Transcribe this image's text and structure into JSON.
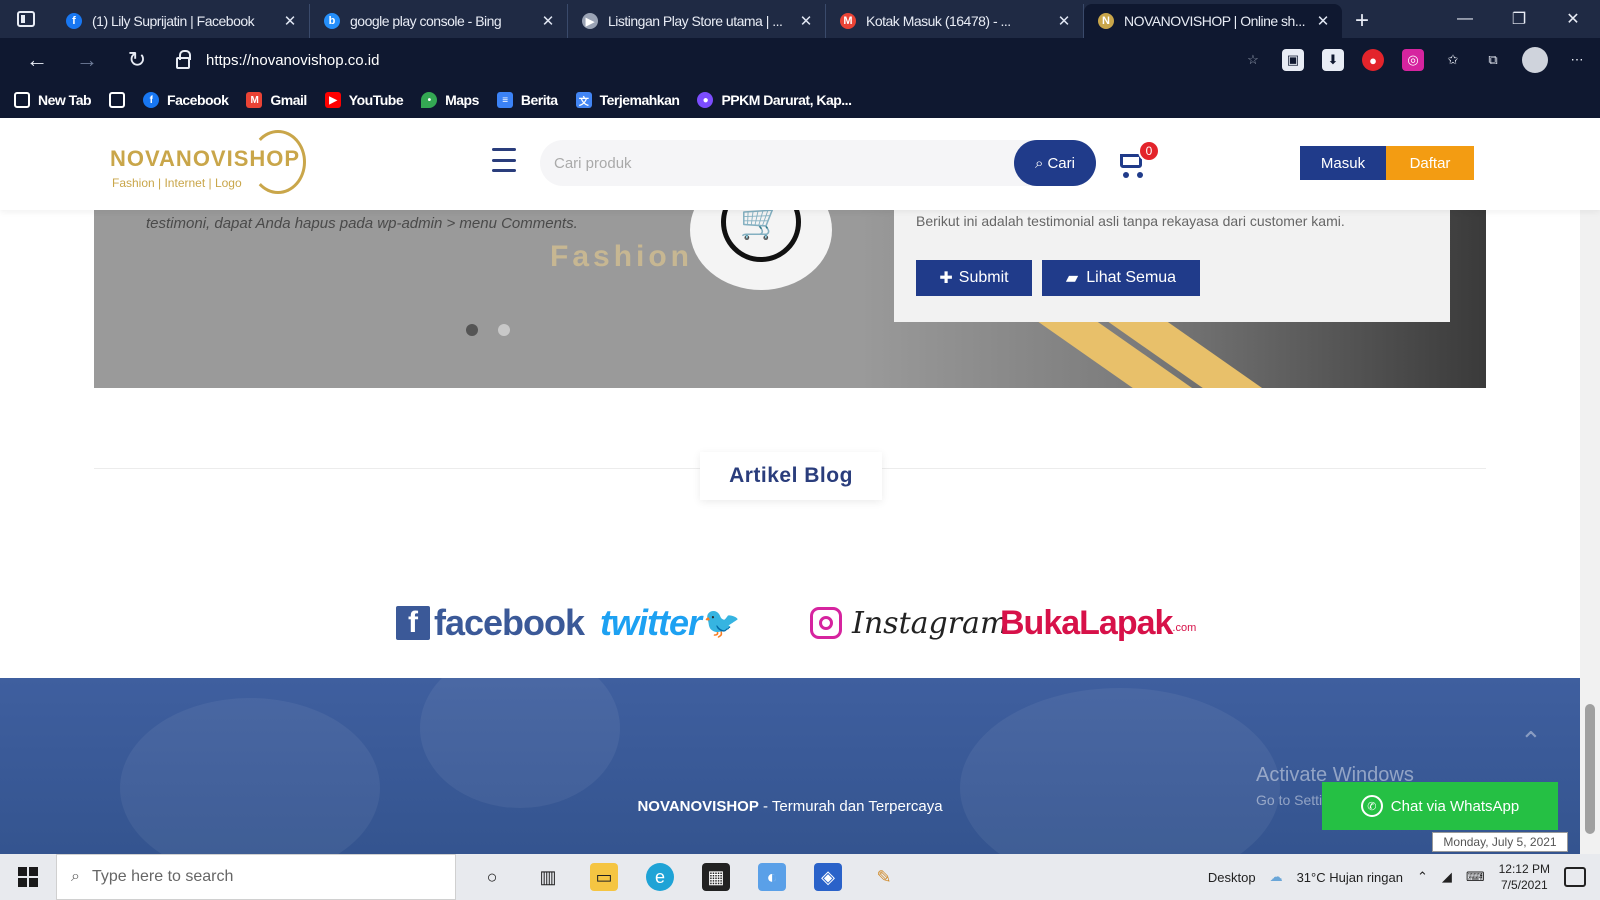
{
  "browser": {
    "tabs": [
      {
        "title": "(1) Lily Suprijatin | Facebook",
        "icon": "facebook-icon",
        "color": "#1877f2"
      },
      {
        "title": "google play console - Bing",
        "icon": "bing-icon",
        "color": "#258ffa"
      },
      {
        "title": "Listingan Play Store utama | ...",
        "icon": "play-console-icon",
        "color": "#9aa3b5"
      },
      {
        "title": "Kotak Masuk (16478) - ...",
        "icon": "gmail-icon",
        "color": "#ea4335"
      },
      {
        "title": "NOVANOVISHOP | Online sh...",
        "icon": "novanovishop-icon",
        "color": "#c9a64a",
        "active": true
      }
    ],
    "new_tab": "+",
    "url": "https://novanovishop.co.id",
    "bookmarks": [
      {
        "label": "New Tab",
        "icon": "page-icon",
        "color": "#0f1830"
      },
      {
        "label": "",
        "icon": "page-icon",
        "color": "#0f1830"
      },
      {
        "label": "Facebook",
        "icon": "facebook-icon",
        "color": "#1877f2"
      },
      {
        "label": "Gmail",
        "icon": "gmail-icon",
        "color": "#ea4335"
      },
      {
        "label": "YouTube",
        "icon": "youtube-icon",
        "color": "#ff0000"
      },
      {
        "label": "Maps",
        "icon": "maps-icon",
        "color": "#34a853"
      },
      {
        "label": "Berita",
        "icon": "news-icon",
        "color": "#3b82f6"
      },
      {
        "label": "Terjemahkan",
        "icon": "translate-icon",
        "color": "#4285f4"
      },
      {
        "label": "PPKM Darurat, Kap...",
        "icon": "news-icon",
        "color": "#7c4dff"
      }
    ]
  },
  "header": {
    "logo_name": "NOVANOVISHOP",
    "logo_tagline": "Fashion | Internet | Logo",
    "search_placeholder": "Cari produk",
    "search_button": "Cari",
    "cart_count": "0",
    "login": "Masuk",
    "register": "Daftar"
  },
  "banner": {
    "testimonial_text": "testimoni, dapat Anda hapus pada wp-admin > menu Comments.",
    "watermark": "Fashion   net",
    "box_text": "Berikut ini adalah testimonial asli tanpa rekayasa dari customer kami.",
    "submit_button": "Submit",
    "view_all_button": "Lihat Semua",
    "slide_count": 2,
    "active_slide": 1
  },
  "blog": {
    "title": "Artikel Blog"
  },
  "social": {
    "facebook": "facebook",
    "twitter": "twitter",
    "instagram": "Instagram",
    "bukalapak": "BukaLapak",
    "bukalapak_suffix": ".com"
  },
  "footer": {
    "brand": "NOVANOVISHOP",
    "tagline": " - Termurah dan Terpercaya",
    "activate_title": "Activate Windows",
    "activate_sub": "Go to Settings",
    "whatsapp": "Chat via WhatsApp",
    "date_tooltip": "Monday, July 5, 2021"
  },
  "taskbar": {
    "search_placeholder": "Type here to search",
    "desktop_label": "Desktop",
    "weather": "31°C  Hujan ringan",
    "time": "12:12 PM",
    "date": "7/5/2021"
  },
  "colors": {
    "brand_blue": "#203b8a",
    "brand_orange": "#f39c12",
    "brand_gold": "#c9a64a",
    "whatsapp_green": "#25c044"
  }
}
